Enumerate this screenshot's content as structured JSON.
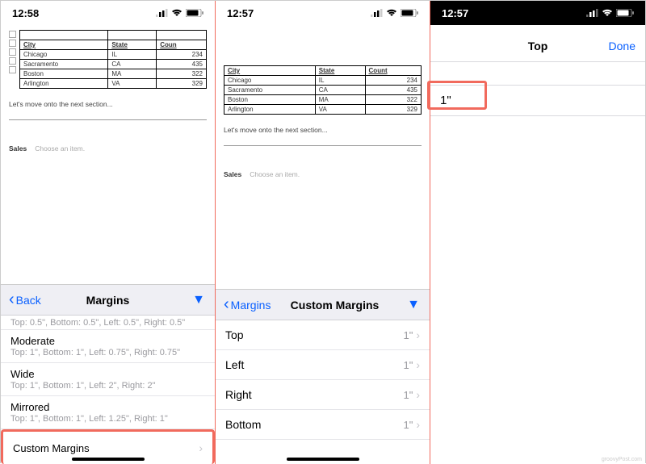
{
  "status": {
    "time1": "12:58",
    "time2": "12:57",
    "time3": "12:57"
  },
  "table": {
    "headers": {
      "city": "City",
      "state": "State",
      "count": "Count"
    },
    "rows": [
      {
        "city": "Chicago",
        "state": "IL",
        "count": "234"
      },
      {
        "city": "Sacramento",
        "state": "CA",
        "count": "435"
      },
      {
        "city": "Boston",
        "state": "MA",
        "count": "322"
      },
      {
        "city": "Arlington",
        "state": "VA",
        "count": "329"
      }
    ]
  },
  "doc": {
    "paragraph": "Let's move onto the next section...",
    "sales_label": "Sales",
    "sales_value": "Choose an item."
  },
  "sheet1": {
    "back": "Back",
    "title": "Margins",
    "truncated": "Top: 0.5\", Bottom: 0.5\", Left: 0.5\", Right: 0.5\"",
    "options": [
      {
        "name": "Moderate",
        "desc": "Top: 1\", Bottom: 1\", Left: 0.75\", Right: 0.75\""
      },
      {
        "name": "Wide",
        "desc": "Top: 1\", Bottom: 1\", Left: 2\", Right: 2\""
      },
      {
        "name": "Mirrored",
        "desc": "Top: 1\", Bottom: 1\", Left: 1.25\", Right: 1\""
      }
    ],
    "custom": "Custom Margins"
  },
  "sheet2": {
    "back": "Margins",
    "title": "Custom Margins",
    "items": [
      {
        "label": "Top",
        "value": "1\""
      },
      {
        "label": "Left",
        "value": "1\""
      },
      {
        "label": "Right",
        "value": "1\""
      },
      {
        "label": "Bottom",
        "value": "1\""
      }
    ]
  },
  "pane3": {
    "title": "Top",
    "done": "Done",
    "value": "1\""
  },
  "watermark": "groovyPost.com"
}
